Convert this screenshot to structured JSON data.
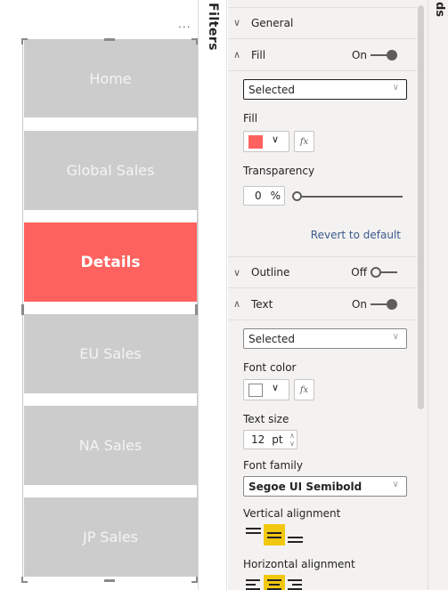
{
  "canvas": {
    "more_options_label": "...",
    "buttons": [
      {
        "label": "Home",
        "active": false
      },
      {
        "label": "Global Sales",
        "active": false
      },
      {
        "label": "Details",
        "active": true
      },
      {
        "label": "EU Sales",
        "active": false
      },
      {
        "label": "NA Sales",
        "active": false
      },
      {
        "label": "JP Sales",
        "active": false
      }
    ],
    "active_color": "#fd625e",
    "inactive_color": "#cccccc"
  },
  "filters_rail": {
    "label": "Filters"
  },
  "right_rail": {
    "label": "ds"
  },
  "format_pane": {
    "sections": {
      "general": {
        "title": "General",
        "expanded": false
      },
      "fill": {
        "title": "Fill",
        "expanded": true,
        "toggle_label": "On",
        "toggle_on": true,
        "state_dropdown": "Selected",
        "fill_label": "Fill",
        "fill_color": "#fd625e",
        "fx_label": "fx",
        "transparency_label": "Transparency",
        "transparency_value": "0",
        "transparency_unit": "%",
        "transparency_percent": 0,
        "revert_label": "Revert to default"
      },
      "outline": {
        "title": "Outline",
        "expanded": false,
        "toggle_label": "Off",
        "toggle_on": false
      },
      "text": {
        "title": "Text",
        "expanded": true,
        "toggle_label": "On",
        "toggle_on": true,
        "state_dropdown": "Selected",
        "font_color_label": "Font color",
        "font_color": "#ffffff",
        "fx_label": "fx",
        "text_size_label": "Text size",
        "text_size_value": "12",
        "text_size_unit": "pt",
        "font_family_label": "Font family",
        "font_family_value": "Segoe UI Semibold",
        "vertical_alignment_label": "Vertical alignment",
        "vertical_alignment_options": [
          "top",
          "middle",
          "bottom"
        ],
        "vertical_alignment_selected": "middle",
        "horizontal_alignment_label": "Horizontal alignment",
        "horizontal_alignment_options": [
          "left",
          "center",
          "right"
        ],
        "horizontal_alignment_selected": "center"
      }
    },
    "highlight_color": "#f2c80f"
  }
}
